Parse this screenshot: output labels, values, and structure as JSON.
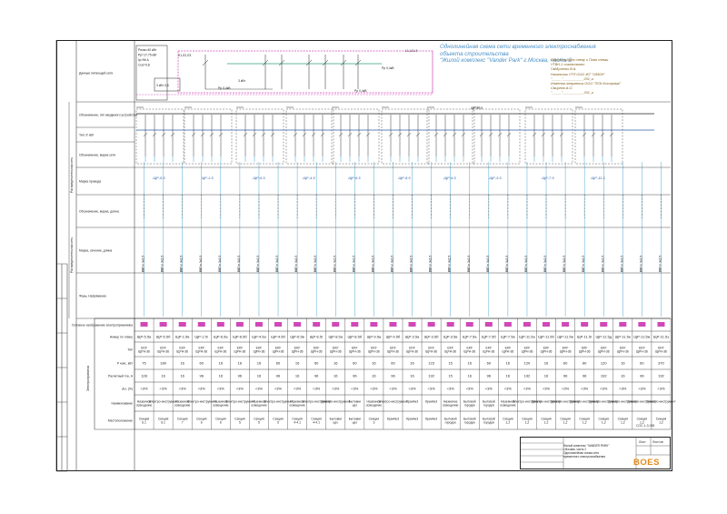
{
  "title": {
    "lines": [
      "Однолинейная схема сети временного электроснабжения",
      "объекта строительства",
      "\"Жилой комплекс \"Vander Park\" г.Москва, часть 2"
    ]
  },
  "signatures": [
    "Однолинейную схему и План схемы",
    "УТВН-1 согласовано:",
    "Гайдученко В.А.",
    "Начальник УТП ООО ЖТ \"ОМОН\"",
    "\"_____\"___________201_г.",
    "Инженер-энергетик ООО \"ПСК Кострома\"",
    "Смирнов А.О.",
    "\"_____\"___________201_г."
  ],
  "left_labels": [
    "Данные питающей сети",
    "Обозначение, тип вводимого устройства",
    "Распределительная сеть",
    "Тип, Р, кВт",
    "Обозначение, марка сети",
    "Марка провода",
    "Обозначение, марка, длина",
    "Распределительная сеть",
    "Фазы, Напряжение",
    "Марка, сечение, длина",
    "Условное изображение электроприемника",
    "Номер по плану",
    "Тип",
    "Р ном., кВт",
    "Расчетный ток, А",
    "ΔU, (%)",
    "Наименование",
    "Местоположение",
    "Электроприемник"
  ],
  "top_feeds": [
    "Рном=40 кВт",
    "Рр=17,75 кВт",
    "Iр=96 А",
    "Cos=0,8",
    "3 кВт 0,8",
    "Рр 0,4кВ"
  ],
  "lines": [
    "Л1,Л2,Л3",
    "L1,L2,L3",
    "ЩР-10,5"
  ],
  "panels": [
    "ЩР-5.5",
    "ЩР-1.5",
    "ЩР-6.5",
    "ЩР-4.5",
    "ЩР-6.5",
    "ЩР-8.5",
    "ЩР-9.5",
    "ЩР-3.5",
    "ЩР-7.5",
    "ЩР-11.5"
  ],
  "consumers": [
    {
      "num": "ЩР-5.5а",
      "type": "EKF ЩРН-36",
      "p": "75",
      "i": "128",
      "du": "<3%",
      "name": "Наземное освещение",
      "loc": "Секция 6.1"
    },
    {
      "num": "ЩР-5.5б",
      "type": "EKF ЩРН-36",
      "p": "180",
      "i": "16",
      "du": "<3%",
      "name": "Электро-инструмент",
      "loc": "Секция 6.1"
    },
    {
      "num": "ЩР-1.5в",
      "type": "EKF ЩРН-36",
      "p": "16",
      "i": "16",
      "du": "<3%",
      "name": "Наземное освещение",
      "loc": "Секция 7"
    },
    {
      "num": "ЩР-1.5г",
      "type": "EKF ЩРН-36",
      "p": "60",
      "i": "96",
      "du": "<3%",
      "name": "Электро-инструмент",
      "loc": "Секция 6"
    },
    {
      "num": "ЩР-6.5а",
      "type": "EKF ЩРН-36",
      "p": "16",
      "i": "16",
      "du": "<3%",
      "name": "Наземное освещение",
      "loc": "Секция 6"
    },
    {
      "num": "ЩР-6.5б",
      "type": "EKF ЩРН-36",
      "p": "16",
      "i": "96",
      "du": "<3%",
      "name": "Электро-инструмент",
      "loc": "Секция 5"
    },
    {
      "num": "ЩР-4.5а",
      "type": "EKF ЩРН-36",
      "p": "16",
      "i": "16",
      "du": "<3%",
      "name": "Наземное освещение",
      "loc": "Секция 5"
    },
    {
      "num": "ЩР-4.5б",
      "type": "EKF ЩРН-36",
      "p": "60",
      "i": "96",
      "du": "<3%",
      "name": "Электро-инструмент",
      "loc": "Секция 5"
    },
    {
      "num": "ЩР-6.5в",
      "type": "EKF ЩРН-36",
      "p": "16",
      "i": "16",
      "du": "<3%",
      "name": "Наземное освещение",
      "loc": "Секция 4-4.1"
    },
    {
      "num": "ЩР-6.5г",
      "type": "EKF ЩРН-36",
      "p": "60",
      "i": "96",
      "du": "<3%",
      "name": "Электро-инструмент",
      "loc": "Секция 4-4.1"
    },
    {
      "num": "ЩР-8.5а",
      "type": "EKF ЩРН-36",
      "p": "16",
      "i": "16",
      "du": "<3%",
      "name": "Электро-инструмент",
      "loc": "Бытовки цех"
    },
    {
      "num": "ЩР-8.5б",
      "type": "EKF ЩРН-36",
      "p": "60",
      "i": "96",
      "du": "<3%",
      "name": "Бытовки цех",
      "loc": "Бытовки цех"
    },
    {
      "num": "ЩР-9.5а",
      "type": "EKF ЩРН-36",
      "p": "16",
      "i": "16",
      "du": "<3%",
      "name": "Наземное освещение",
      "loc": "Секция 3"
    },
    {
      "num": "ЩР-9.5б",
      "type": "EKF ЩРН-36",
      "p": "60",
      "i": "96",
      "du": "<3%",
      "name": "Электро-инструмент",
      "loc": "Кран№3"
    },
    {
      "num": "ЩР-3.5а",
      "type": "EKF ЩРН-36",
      "p": "16",
      "i": "16",
      "du": "<3%",
      "name": "Кран№3",
      "loc": "Кран№3"
    },
    {
      "num": "ЩР-3.5б",
      "type": "EKF ЩРН-36",
      "p": "123",
      "i": "192",
      "du": "<3%",
      "name": "Кран№3",
      "loc": "Кран№3"
    },
    {
      "num": "ЩР-3.5в",
      "type": "EKF ЩРН-36",
      "p": "15",
      "i": "15",
      "du": "<3%",
      "name": "Наземное освещение",
      "loc": "Бытовой городок"
    },
    {
      "num": "ЩР-7.5а",
      "type": "EKF ЩРН-36",
      "p": "16",
      "i": "16",
      "du": "<3%",
      "name": "Бытовой городок",
      "loc": "Бытовой городок"
    },
    {
      "num": "ЩР-7.5б",
      "type": "EKF ЩРН-36",
      "p": "60",
      "i": "96",
      "du": "<3%",
      "name": "Бытовой городок",
      "loc": "Бытовой городок"
    },
    {
      "num": "ЩР-7.5в",
      "type": "EKF ЩРН-36",
      "p": "16",
      "i": "16",
      "du": "<3%",
      "name": "Наземное освещение",
      "loc": "Секция 1,2"
    },
    {
      "num": "ЩР-11.5а",
      "type": "EKF ЩРН-36",
      "p": "120",
      "i": "192",
      "du": "<3%",
      "name": "Электро-инструмент",
      "loc": "Секция 1,2"
    },
    {
      "num": "ЩР-11.5б",
      "type": "EKF ЩРН-36",
      "p": "16",
      "i": "16",
      "du": "<3%",
      "name": "Электро-инструмент",
      "loc": "Секция 1,2"
    },
    {
      "num": "ЩР-11.5в",
      "type": "EKF ЩРН-36",
      "p": "60",
      "i": "96",
      "du": "<3%",
      "name": "Электро-инструмент",
      "loc": "Секция 1,2"
    },
    {
      "num": "ЩР-11.5г",
      "type": "EKF ЩРН-36",
      "p": "60",
      "i": "96",
      "du": "<3%",
      "name": "Электро-инструмент",
      "loc": "Секция 1,2"
    },
    {
      "num": "ЩР-11.5д",
      "type": "EKF ЩРН-36",
      "p": "120",
      "i": "192",
      "du": "<3%",
      "name": "Электро-инструмент",
      "loc": "Секция 1,2"
    },
    {
      "num": "ЩР-11.5е",
      "type": "EKF ЩРН-36",
      "p": "16",
      "i": "16",
      "du": "<3%",
      "name": "Электро-инструмент",
      "loc": "Секция 1,2"
    },
    {
      "num": "ЩР-11.5ж",
      "type": "EKF ЩРН-36",
      "p": "60",
      "i": "96",
      "du": "<3%",
      "name": "Электро-инструмент",
      "loc": "Секция 1,2"
    },
    {
      "num": "ЩР-11.5з",
      "type": "EKF ЩРН-36",
      "p": "370",
      "i": "192",
      "du": "<3%",
      "name": "Электро-инструмент",
      "loc": "Секция 1,2"
    }
  ],
  "stamp": {
    "desc": [
      "Жилой комплекс \"VANDER PARK\"",
      "г.Москва, часть 2",
      "Однолинейная схема сети",
      "временного электроснабжения"
    ],
    "sheet_label": "Лист",
    "sheets_label": "Листов",
    "logo": "BOES",
    "code": "СОС-1-3-035"
  },
  "colors": {
    "accent": "#2b5fa8",
    "magenta": "#d048b8",
    "green": "#2fa070",
    "cable": "#3d9fd0",
    "logo": "#e48a1a"
  }
}
